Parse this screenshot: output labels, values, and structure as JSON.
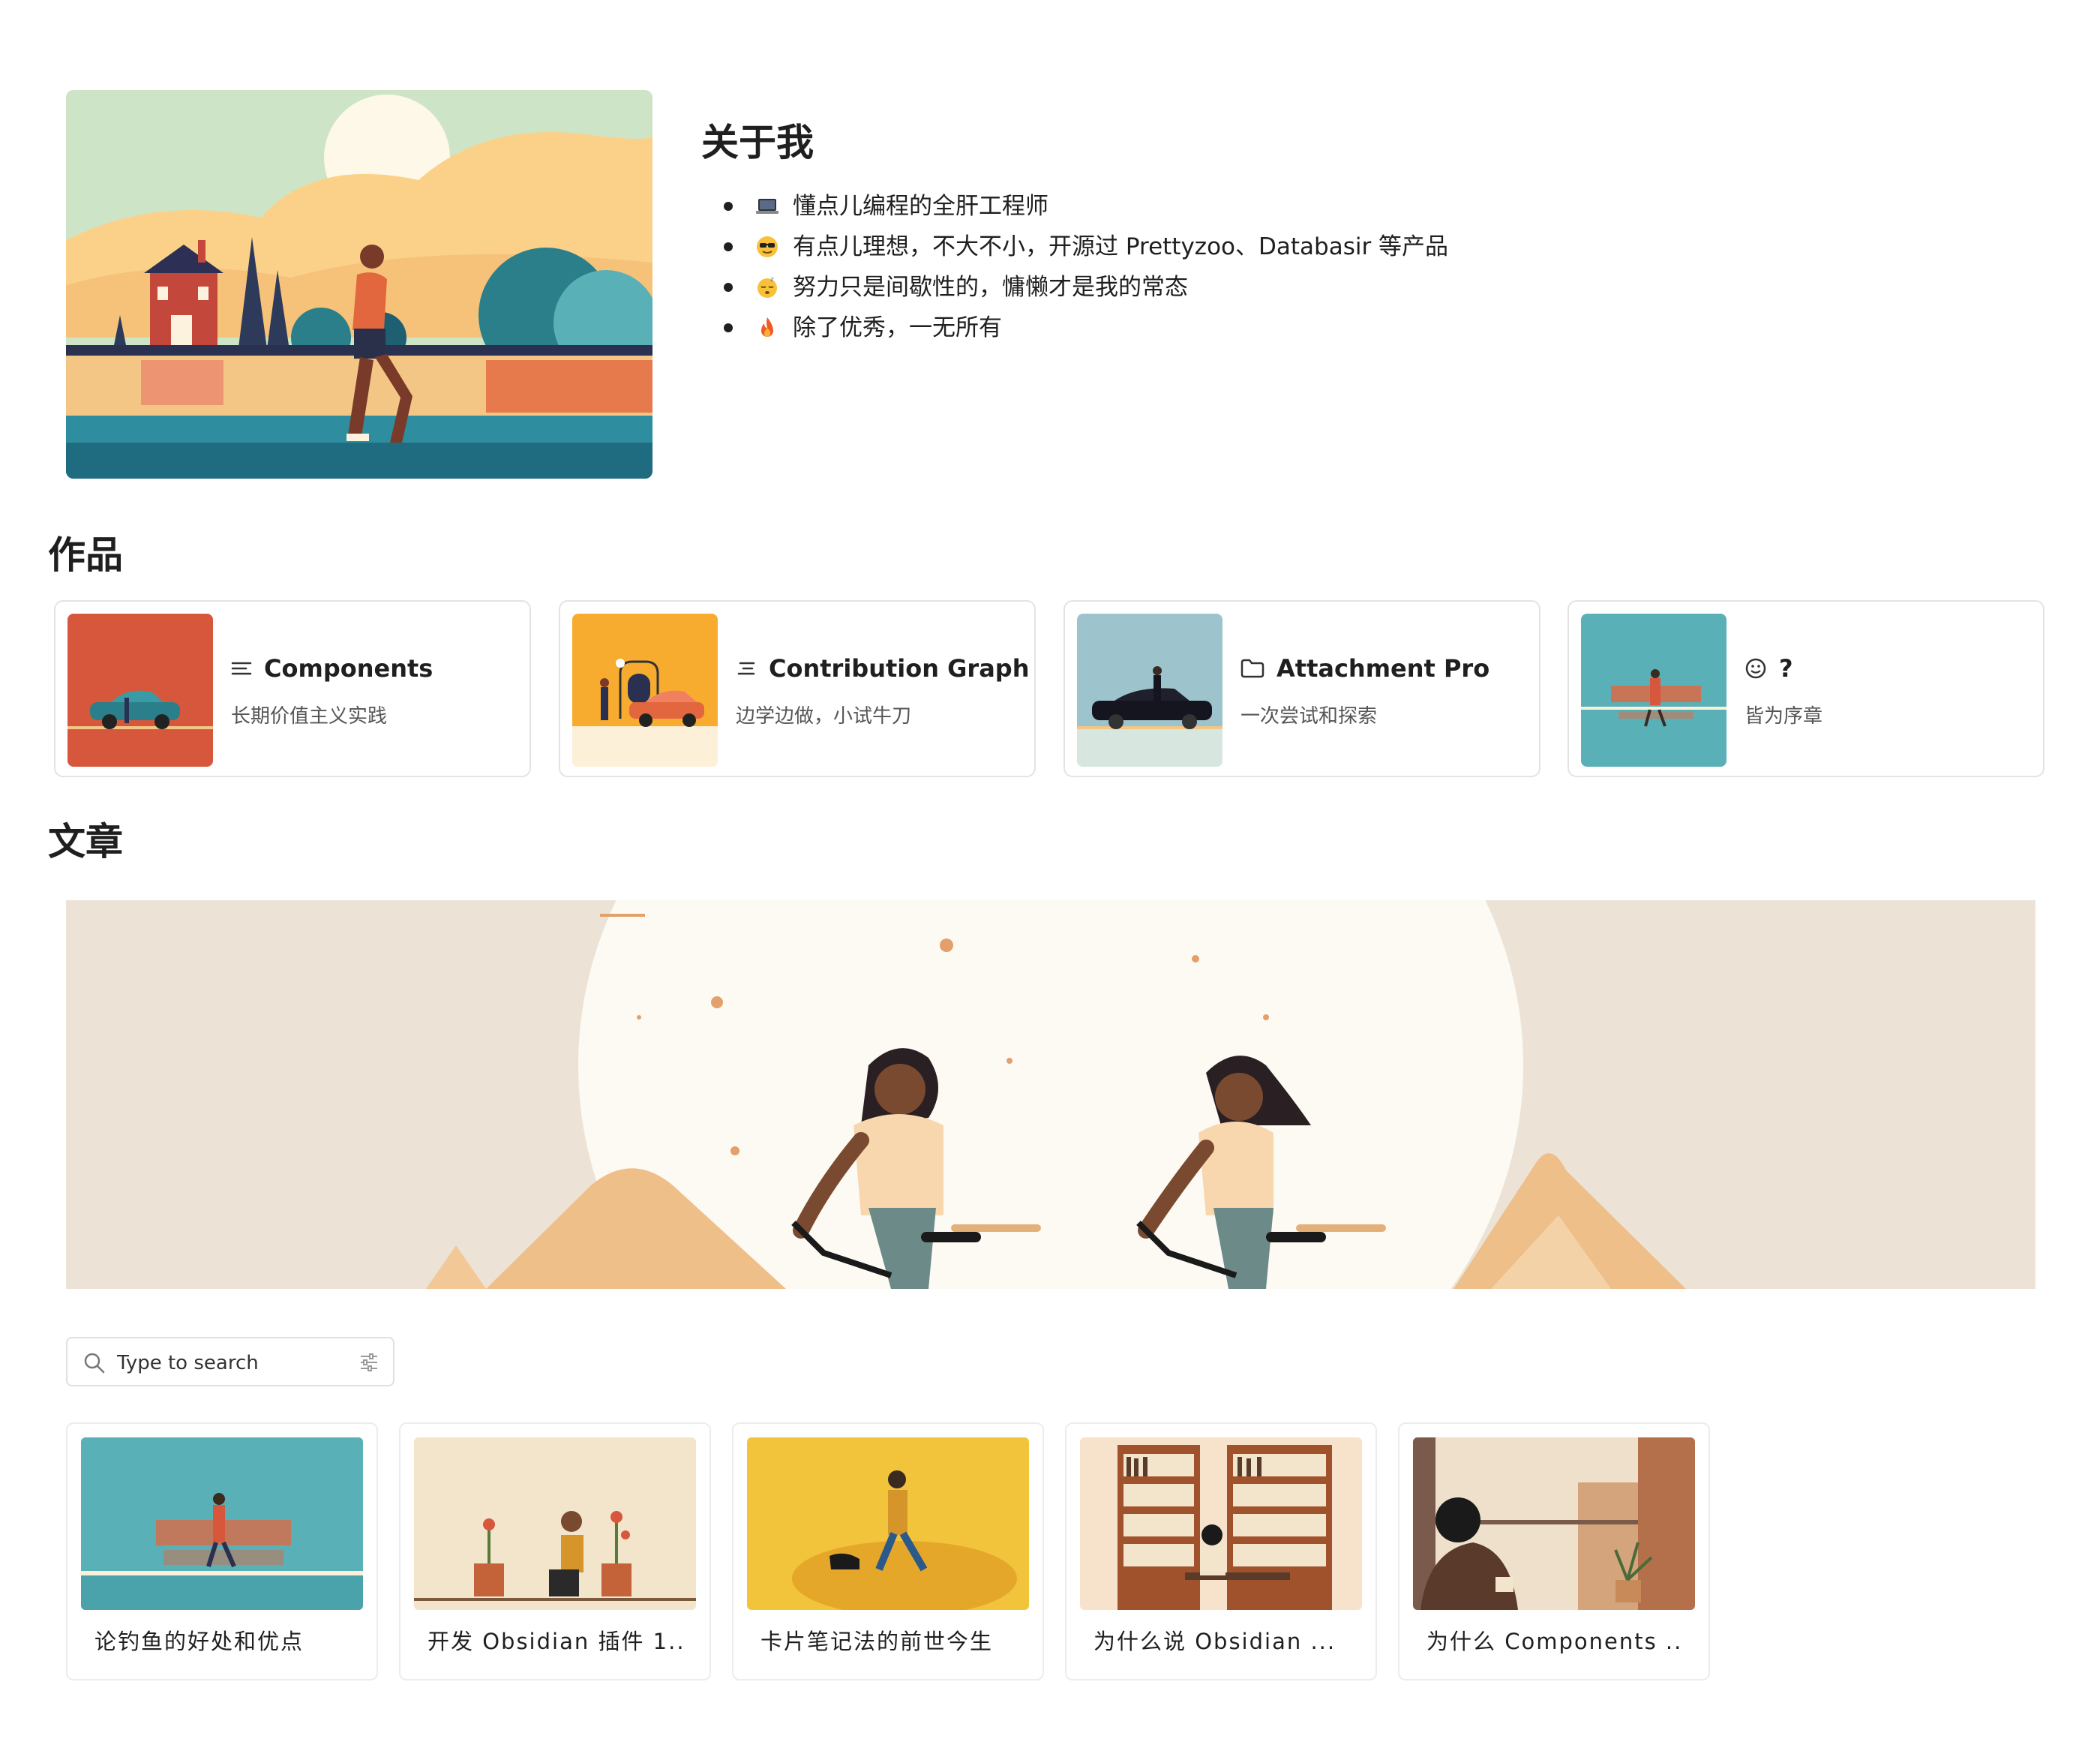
{
  "about": {
    "title": "关于我",
    "items": [
      {
        "emoji": "laptop-emoji",
        "text": "懂点儿编程的全肝工程师"
      },
      {
        "emoji": "sunglasses-emoji",
        "text": "有点儿理想，不大不小，开源过 Prettyzoo、Databasir 等产品"
      },
      {
        "emoji": "sleepy-emoji",
        "text": "努力只是间歇性的，慵懒才是我的常态"
      },
      {
        "emoji": "fire-emoji",
        "text": "除了优秀，一无所有"
      }
    ]
  },
  "works": {
    "title": "作品",
    "cards": [
      {
        "icon": "lines-icon",
        "title": "Components",
        "subtitle": "长期价值主义实践",
        "thumb_color": "#d6573c"
      },
      {
        "icon": "contribution-icon",
        "title": "Contribution Graph",
        "subtitle": "边学边做，小试牛刀",
        "thumb_color": "#f7ac30"
      },
      {
        "icon": "folder-icon",
        "title": "Attachment Pro",
        "subtitle": "一次尝试和探索",
        "thumb_color": "#9dc4cc"
      },
      {
        "icon": "smile-icon",
        "title": "?",
        "subtitle": "皆为序章",
        "thumb_color": "#5ab0b7"
      }
    ]
  },
  "articles": {
    "title": "文章",
    "search": {
      "placeholder": "Type to search"
    },
    "cards": [
      {
        "title": "论钓鱼的好处和优点",
        "thumb_color": "#5ab0b7"
      },
      {
        "title": "开发 Obsidian 插件 1...",
        "thumb_color": "#f3e4cc"
      },
      {
        "title": "卡片笔记法的前世今生",
        "thumb_color": "#f2c43b"
      },
      {
        "title": "为什么说 Obsidian ...",
        "thumb_color": "#f7e3cc"
      },
      {
        "title": "为什么 Components ...",
        "thumb_color": "#efe0cc"
      }
    ]
  }
}
